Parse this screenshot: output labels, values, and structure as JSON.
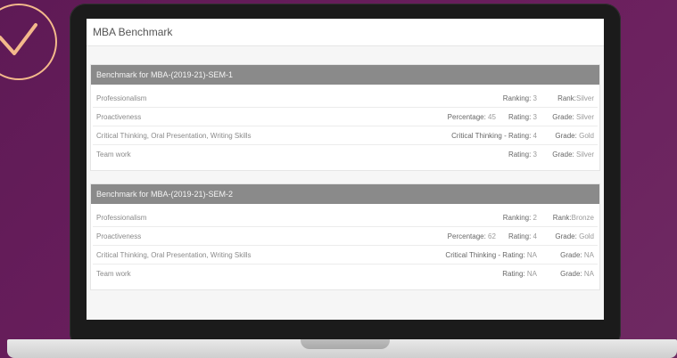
{
  "page": {
    "title": "MBA Benchmark",
    "colors": {
      "background": "#6b1f5e",
      "panel_header": "#8a8a8a",
      "badge": "#f3b98b"
    },
    "badge_icon": "checkmark-icon"
  },
  "sections": [
    {
      "title": "Benchmark for MBA-(2019-21)-SEM-1",
      "rows": [
        {
          "label": "Professionalism",
          "cells": [
            {
              "k": "Ranking:",
              "v": "3"
            },
            {
              "k": "Rank:",
              "v": "Silver"
            }
          ]
        },
        {
          "label": "Proactiveness",
          "cells": [
            {
              "k": "Percentage:",
              "v": "45"
            },
            {
              "k": "Rating:",
              "v": "3"
            },
            {
              "k": "Grade:",
              "v": "Silver"
            }
          ]
        },
        {
          "label": "Critical Thinking, Oral Presentation, Writing Skills",
          "cells": [
            {
              "k": "Critical Thinking - Rating:",
              "v": "4"
            },
            {
              "k": "Grade:",
              "v": "Gold"
            }
          ]
        },
        {
          "label": "Team work",
          "cells": [
            {
              "k": "Rating:",
              "v": "3"
            },
            {
              "k": "Grade:",
              "v": "Silver"
            }
          ]
        }
      ]
    },
    {
      "title": "Benchmark for MBA-(2019-21)-SEM-2",
      "rows": [
        {
          "label": "Professionalism",
          "cells": [
            {
              "k": "Ranking:",
              "v": "2"
            },
            {
              "k": "Rank:",
              "v": "Bronze"
            }
          ]
        },
        {
          "label": "Proactiveness",
          "cells": [
            {
              "k": "Percentage:",
              "v": "62"
            },
            {
              "k": "Rating:",
              "v": "4"
            },
            {
              "k": "Grade:",
              "v": "Gold"
            }
          ]
        },
        {
          "label": "Critical Thinking, Oral Presentation, Writing Skills",
          "cells": [
            {
              "k": "Critical Thinking - Rating:",
              "v": "NA"
            },
            {
              "k": "Grade:",
              "v": "NA"
            }
          ]
        },
        {
          "label": "Team work",
          "cells": [
            {
              "k": "Rating:",
              "v": "NA"
            },
            {
              "k": "Grade:",
              "v": "NA"
            }
          ]
        }
      ]
    }
  ]
}
